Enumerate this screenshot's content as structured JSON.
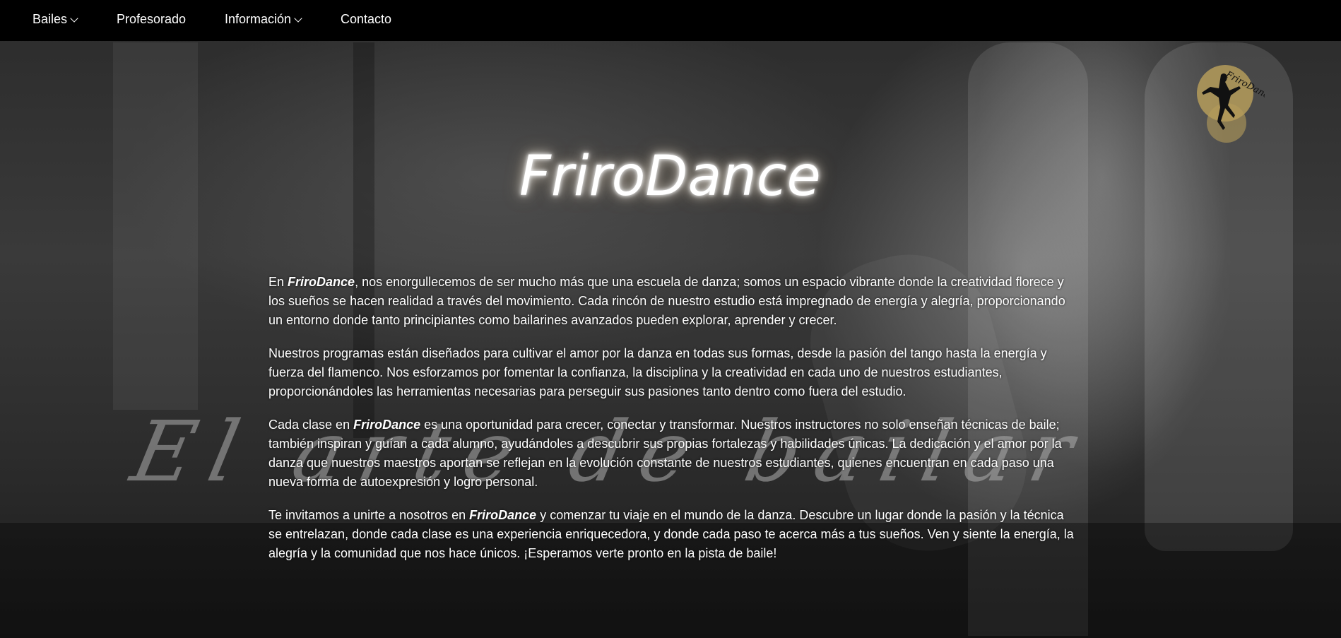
{
  "nav": {
    "items": [
      {
        "label": "Bailes",
        "has_dropdown": true
      },
      {
        "label": "Profesorado",
        "has_dropdown": false
      },
      {
        "label": "Información",
        "has_dropdown": true
      },
      {
        "label": "Contacto",
        "has_dropdown": false
      }
    ]
  },
  "logo": {
    "icon": "dancer-silhouette-logo",
    "text": "FriroDance"
  },
  "hero": {
    "title": "FriroDance",
    "watermark": "El arte de bailar"
  },
  "paragraphs": [
    {
      "parts": [
        "En ",
        "FriroDance",
        ", nos enorgullecemos de ser mucho más que una escuela de danza; somos un espacio vibrante donde la creatividad florece y los sueños se hacen realidad a través del movimiento. Cada rincón de nuestro estudio está impregnado de energía y alegría, proporcionando un entorno donde tanto principiantes como bailarines avanzados pueden explorar, aprender y crecer."
      ]
    },
    {
      "parts": [
        "Nuestros programas están diseñados para cultivar el amor por la danza en todas sus formas, desde la pasión del tango hasta la energía y fuerza del flamenco. Nos esforzamos por fomentar la confianza, la disciplina y la creatividad en cada uno de nuestros estudiantes, proporcionándoles las herramientas necesarias para perseguir sus pasiones tanto dentro como fuera del estudio.",
        "",
        ""
      ]
    },
    {
      "parts": [
        "Cada clase en ",
        "FriroDance",
        " es una oportunidad para crecer, conectar y transformar. Nuestros instructores no solo enseñan técnicas de baile; también inspiran y guían a cada alumno, ayudándoles a descubrir sus propias fortalezas y habilidades únicas. La dedicación y el amor por la danza que nuestros maestros aportan se reflejan en la evolución constante de nuestros estudiantes, quienes encuentran en cada paso una nueva forma de autoexpresión y logro personal."
      ]
    },
    {
      "parts": [
        "Te invitamos a unirte a nosotros en ",
        "FriroDance",
        " y comenzar tu viaje en el mundo de la danza. Descubre un lugar donde la pasión y la técnica se entrelazan, donde cada clase es una experiencia enriquecedora, y donde cada paso te acerca más a tus sueños. Ven y siente la energía, la alegría y la comunidad que nos hace únicos. ¡Esperamos verte pronto en la pista de baile!"
      ]
    }
  ],
  "colors": {
    "navbar": "#000000",
    "text": "#ffffff",
    "logo_gold": "#b59c5a"
  }
}
